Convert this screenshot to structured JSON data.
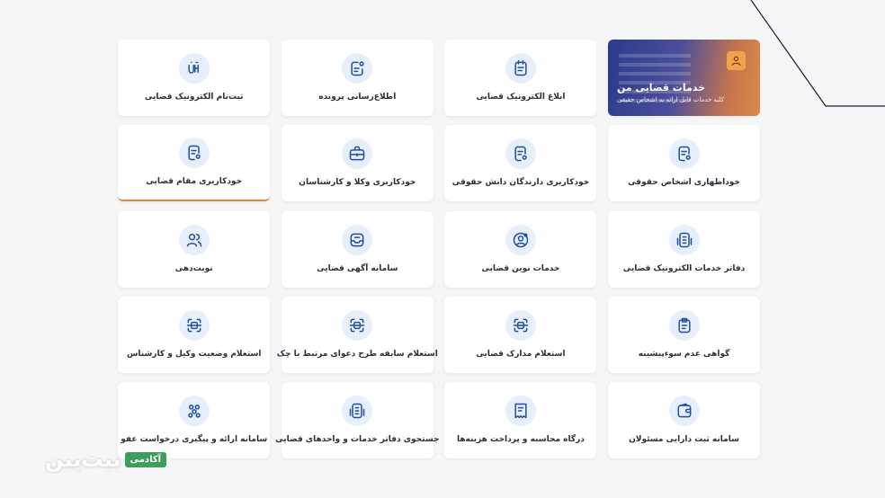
{
  "hero": {
    "title": "خدمات قضایی من",
    "subtitle": "کلیه خدمات قابل ارائه به اشخاص حقیقی",
    "icon": "user-icon"
  },
  "cards": [
    {
      "label": "ابلاغ الکترونیک قضایی",
      "icon": "notice-icon"
    },
    {
      "label": "اطلاع‌رسانی پرونده",
      "icon": "case-info-icon"
    },
    {
      "label": "ثبت‌نام الکترونیک قضایی",
      "icon": "sana-logo-icon"
    },
    {
      "label": "خوداظهاری اشخاص حقوقی",
      "icon": "self-declare-icon"
    },
    {
      "label": "خودکاربری دارندگان دانش حقوقی",
      "icon": "self-declare-icon"
    },
    {
      "label": "خودکاربری وکلا و کارشناسان",
      "icon": "briefcase-icon"
    },
    {
      "label": "خودکاربری مقام قضایی",
      "icon": "self-declare-icon",
      "active": true
    },
    {
      "label": "دفاتر خدمات الکترونیک قضایی",
      "icon": "office-icon"
    },
    {
      "label": "خدمات نوین قضایی",
      "icon": "user-gear-icon"
    },
    {
      "label": "سامانه آگهی قضایی",
      "icon": "inbox-icon"
    },
    {
      "label": "نوبت‌دهی",
      "icon": "users-icon"
    },
    {
      "label": "گواهی عدم سوءپیشینه",
      "icon": "clipboard-icon"
    },
    {
      "label": "استعلام مدارک قضایی",
      "icon": "scan-icon"
    },
    {
      "label": "استعلام سابقه طرح دعوای مرتبط با چک",
      "icon": "scan-icon"
    },
    {
      "label": "استعلام وضعیت وکیل و کارشناس",
      "icon": "scan-icon"
    },
    {
      "label": "سامانه ثبت دارایی مسئولان",
      "icon": "wallet-icon"
    },
    {
      "label": "درگاه محاسبه و پرداخت هزینه‌ها",
      "icon": "receipt-icon"
    },
    {
      "label": "جستجوی دفاتر خدمات و واحدهای قضایی",
      "icon": "office-icon"
    },
    {
      "label": "سامانه ارائه و پیگیری درخواست عفو",
      "icon": "network-icon"
    }
  ],
  "watermark": {
    "brand": "بیت‌پین",
    "tag": "آکادمی"
  },
  "colors": {
    "accent": "#1f4fa3",
    "icon_bg": "#e6effb",
    "active_border": "#e08a3c",
    "watermark_tag": "#3d9d5a"
  }
}
